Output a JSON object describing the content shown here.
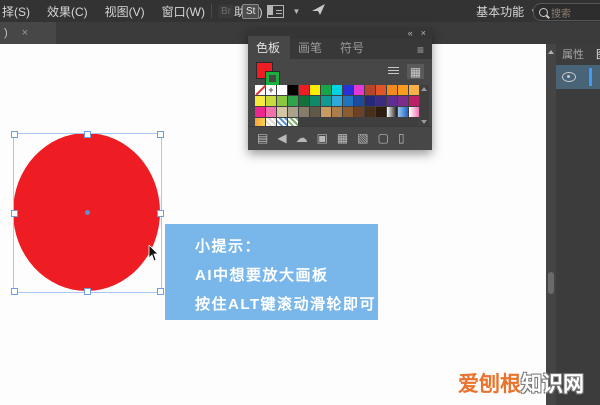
{
  "menubar": {
    "items": [
      "择(S)",
      "效果(C)",
      "视图(V)",
      "窗口(W)",
      "帮助(H)"
    ],
    "br_badge": "Br",
    "st_badge": "St",
    "workspace_label": "基本功能",
    "search_placeholder": "搜索"
  },
  "doc_tab": {
    "label": ")",
    "close": "×"
  },
  "swatches_panel": {
    "collapse_icon": "«",
    "close_icon": "×",
    "tabs": [
      "色板",
      "画笔",
      "符号"
    ],
    "menu_icon": "≡",
    "fill_color": "#ee1c23",
    "stroke_color": "#17b03c",
    "rows": [
      [
        "none",
        "reg",
        "#ffffff",
        "#000000",
        "#ee1c23",
        "#fdee02",
        "#15a64c",
        "#00d4e4",
        "#2b2fd8",
        "#e338d3",
        "#b7452e",
        "#e05429",
        "#f28a1e",
        "#f79d1e",
        "#f9b04a"
      ],
      [
        "#f6ea3c",
        "#c9da3b",
        "#8cc63f",
        "#2fa44a",
        "#14713b",
        "#0f8a68",
        "#109a91",
        "#2fa9dc",
        "#2173bc",
        "#1c4b9d",
        "#25297c",
        "#3d2b82",
        "#5d2d91",
        "#7e2c8c",
        "#bc1e67"
      ],
      [
        "#ec268f",
        "#f171ad",
        "#d3c6a2",
        "#a9a18b",
        "#857d6a",
        "#5f594a",
        "#c89a63",
        "#ab7d4b",
        "#8a5d33",
        "#6b4226",
        "#49301b",
        "#2d1c0f",
        "lg:#fefefe,#1a1a1a",
        "lg:#9cc6f0,#1e63c8",
        "lg:#ffffff,#f473b4"
      ],
      [
        "lg:#f9a13c,#f6d44a",
        "pat:#dcd8cc",
        "pat:#5b8fd0",
        "pat:#7fb069"
      ]
    ],
    "toolbar_icons": [
      {
        "name": "swatch-libraries",
        "glyph": "▤"
      },
      {
        "name": "swatch-kinds",
        "glyph": "◀"
      },
      {
        "name": "color-themes",
        "glyph": "☁"
      },
      {
        "name": "swatch-options",
        "glyph": "▣"
      },
      {
        "name": "color-table",
        "glyph": "▦"
      },
      {
        "name": "new-color-group",
        "glyph": "▧"
      },
      {
        "name": "new-swatch",
        "glyph": "▢"
      },
      {
        "name": "delete-swatch",
        "glyph": "▯"
      }
    ]
  },
  "tooltip": {
    "bg_color": "#79b7ea",
    "lines": [
      "小提示：",
      "AI中想要放大画板",
      "按住ALT键滚动滑轮即可"
    ]
  },
  "canvas": {
    "circle_color": "#ee1c23",
    "selection_color": "#a9c8ef"
  },
  "right_panel": {
    "tabs": [
      "属性",
      "图层"
    ]
  },
  "watermark": {
    "part1": "爱刨根",
    "part2": "知识网",
    "accent_color": "#e9732c"
  }
}
